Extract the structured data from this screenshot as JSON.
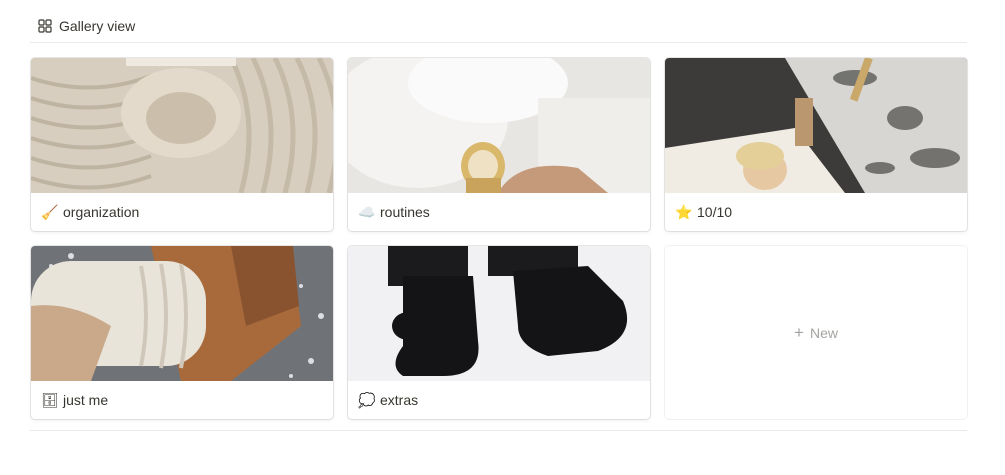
{
  "view": {
    "label": "Gallery view",
    "icon": "gallery-grid-icon"
  },
  "cards": [
    {
      "title": "organization",
      "emoji": "🧹",
      "icon": "broom-icon"
    },
    {
      "title": "routines",
      "emoji": "☁️",
      "icon": "cloud-icon"
    },
    {
      "title": "10/10",
      "emoji": "⭐",
      "icon": "star-icon"
    },
    {
      "title": "just me",
      "emoji": "🗄",
      "icon": "cabinet-icon"
    },
    {
      "title": "extras",
      "emoji": "💭",
      "icon": "thought-bubble-icon"
    }
  ],
  "new_card": {
    "label": "New",
    "icon": "plus-icon"
  },
  "colors": {
    "text": "#37352f",
    "muted": "#a5a4a0",
    "border": "#e9e9e7"
  }
}
